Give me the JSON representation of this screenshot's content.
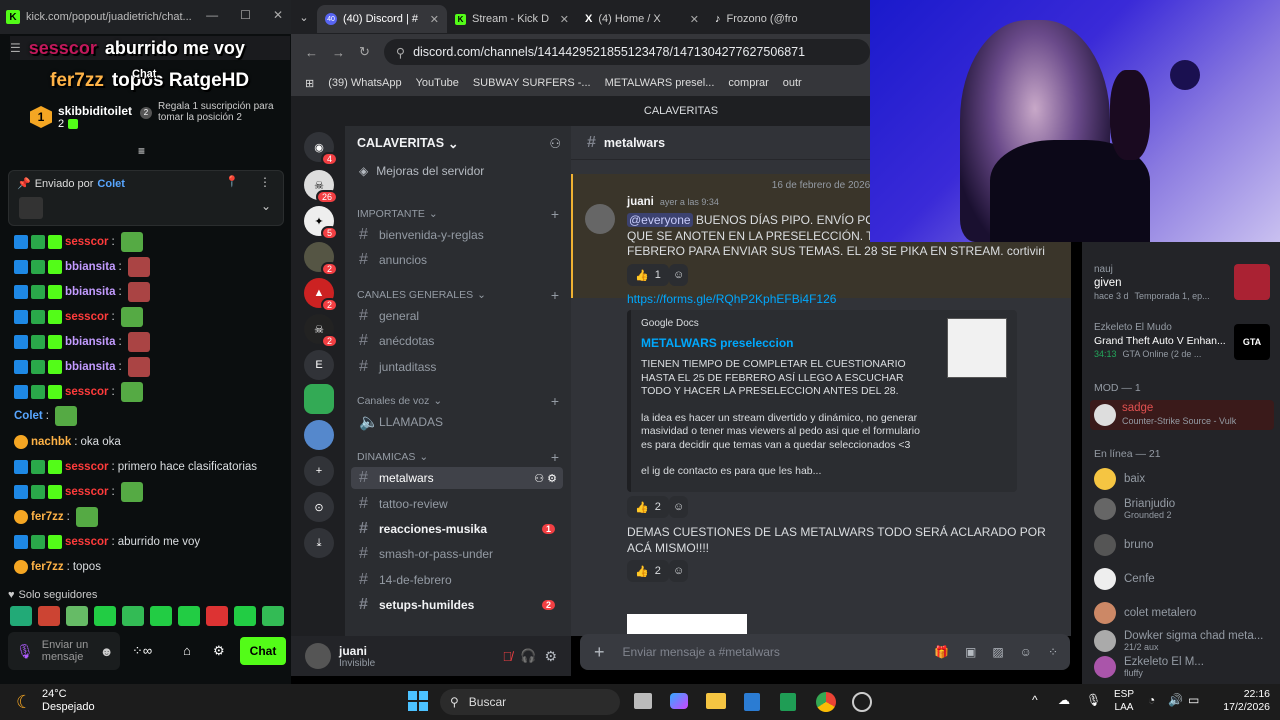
{
  "kick": {
    "window_url": "kick.com/popout/juadietrich/chat...",
    "overlay_top_user": "sesscor",
    "overlay_top_msg": "aburrido me voy",
    "overlay_chat_label": "Chat",
    "overlay_bottom_user": "fer7zz",
    "overlay_bottom_msg": "topos RatgeHD",
    "leaderboard_user": "skibbiditoilet",
    "leaderboard_count": "2",
    "leaderboard_rank": "1",
    "leaderboard_gift_rank": "2",
    "leaderboard_gift_text": "Regala 1 suscripción para tomar la posición 2",
    "pinned_label": "Enviado por",
    "pinned_user": "Colet",
    "messages": [
      {
        "user": "sesscor",
        "text": "",
        "color": "red"
      },
      {
        "user": "bbiansita",
        "text": "",
        "color": "pur"
      },
      {
        "user": "bbiansita",
        "text": "",
        "color": "pur"
      },
      {
        "user": "sesscor",
        "text": "",
        "color": "red"
      },
      {
        "user": "bbiansita",
        "text": "",
        "color": "pur"
      },
      {
        "user": "bbiansita",
        "text": "",
        "color": "pur"
      },
      {
        "user": "sesscor",
        "text": "",
        "color": "red"
      },
      {
        "user": "Colet",
        "text": "",
        "color": "blu"
      },
      {
        "user": "nachbk",
        "text": "oka oka",
        "color": "org"
      },
      {
        "user": "sesscor",
        "text": "primero hace clasificatorias",
        "color": "red"
      },
      {
        "user": "sesscor",
        "text": "",
        "color": "red"
      },
      {
        "user": "fer7zz",
        "text": "",
        "color": "org"
      },
      {
        "user": "sesscor",
        "text": "aburrido me voy",
        "color": "red"
      },
      {
        "user": "fer7zz",
        "text": "topos",
        "color": "org"
      }
    ],
    "followers_only": "Solo seguidores",
    "input_placeholder": "Enviar un mensaje",
    "chat_button": "Chat"
  },
  "browser": {
    "tabs": [
      {
        "label": "(40) Discord | #",
        "badge": "40",
        "active": true
      },
      {
        "label": "Stream - Kick D",
        "active": false
      },
      {
        "label": "(4) Home / X",
        "active": false
      },
      {
        "label": "Frozono (@fro",
        "active": false
      }
    ],
    "url": "discord.com/channels/1414429521855123478/1471304277627506871",
    "bookmarks": [
      "(39) WhatsApp",
      "YouTube",
      "SUBWAY SURFERS -...",
      "METALWARS presel...",
      "comprar",
      "outr"
    ]
  },
  "discord": {
    "server_topbar": "CALAVERITAS",
    "server_name": "CALAVERITAS",
    "server_boost": "Mejoras del servidor",
    "categories": [
      {
        "name": "IMPORTANTE",
        "channels": [
          "bienvenida-y-reglas",
          "anuncios"
        ]
      },
      {
        "name": "CANALES GENERALES",
        "channels": [
          "general",
          "anécdotas",
          "juntaditass"
        ]
      },
      {
        "name": "Canales de voz",
        "channels": [
          "LLAMADAS"
        ]
      },
      {
        "name": "DINAMICAS",
        "channels": [
          "metalwars",
          "tattoo-review",
          "reacciones-musika",
          "smash-or-pass-under",
          "14-de-febrero",
          "setups-humildes"
        ]
      }
    ],
    "unread_counts": {
      "reacciones": "1",
      "setups": "2"
    },
    "guild_badges": [
      "4",
      "26",
      "5",
      "2",
      "2",
      "2"
    ],
    "guild_letter": "E",
    "current_user": "juani",
    "current_status": "Invisible",
    "channel_name": "metalwars",
    "date_divider": "16 de febrero de 2026",
    "author": "juani",
    "timestamp": "ayer a las 9:34",
    "mention": "@everyone",
    "msg_line1": "BUENOS DÍAS PIPO. ENVÍO POR AC",
    "msg_line2": "QUE SE ANOTEN EN LA PRESELECCIÓN. TIENE",
    "msg_line3": "FEBRERO PARA ENVIAR SUS TEMAS. EL 28 SE PIKA EN STREAM. cortiviri",
    "react1_count": "1",
    "link": "https://forms.gle/RQhP2KphEFBi4F126",
    "embed_provider": "Google Docs",
    "embed_title": "METALWARS preseleccion",
    "embed_desc1": "TIENEN TIEMPO DE COMPLETAR EL CUESTIONARIO HASTA EL 25 DE FEBRERO ASÍ LLEGO A ESCUCHAR TODO Y HACER LA PRESELECCION ANTES DEL 28.",
    "embed_desc2": "la idea es hacer un stream divertido y dinámico, no generar masividad o tener mas viewers al pedo asi que el formulario es para decidir que temas van a quedar seleccionados <3",
    "embed_desc3": "el ig de contacto es para que les hab...",
    "react2_count": "2",
    "msg2": "DEMAS CUESTIONES DE LAS METALWARS TODO SERÁ ACLARADO POR ACÁ MISMO!!!!",
    "react3_count": "2",
    "composer_placeholder": "Enviar mensaje a #metalwars"
  },
  "members": {
    "activity": [
      {
        "name": "nauj",
        "detail": "given",
        "sub": "hace 3 d",
        "sub2": "Temporada 1, ep..."
      },
      {
        "name": "Ezkeleto El Mudo",
        "detail": "Grand Theft Auto V Enhan...",
        "sub": "34:13",
        "sub2": "GTA Online (2 de ..."
      }
    ],
    "mod_header": "MOD — 1",
    "mod_user": "sadge",
    "mod_status": "Counter-Strike Source - Vulk",
    "online_header": "En línea — 21",
    "online": [
      {
        "name": "baix",
        "sub": ""
      },
      {
        "name": "Brianjudio",
        "sub": "Grounded 2"
      },
      {
        "name": "bruno",
        "sub": ""
      },
      {
        "name": "Cenfe",
        "sub": ""
      },
      {
        "name": "colet metalero",
        "sub": ""
      },
      {
        "name": "Dowker sigma chad meta...",
        "sub": "21/2 aux"
      },
      {
        "name": "Ezkeleto El M...",
        "sub": "fluffy"
      }
    ]
  },
  "taskbar": {
    "temp": "24°C",
    "weather": "Despejado",
    "search": "Buscar",
    "lang1": "ESP",
    "lang2": "LAA",
    "time": "22:16",
    "date": "17/2/2026"
  }
}
